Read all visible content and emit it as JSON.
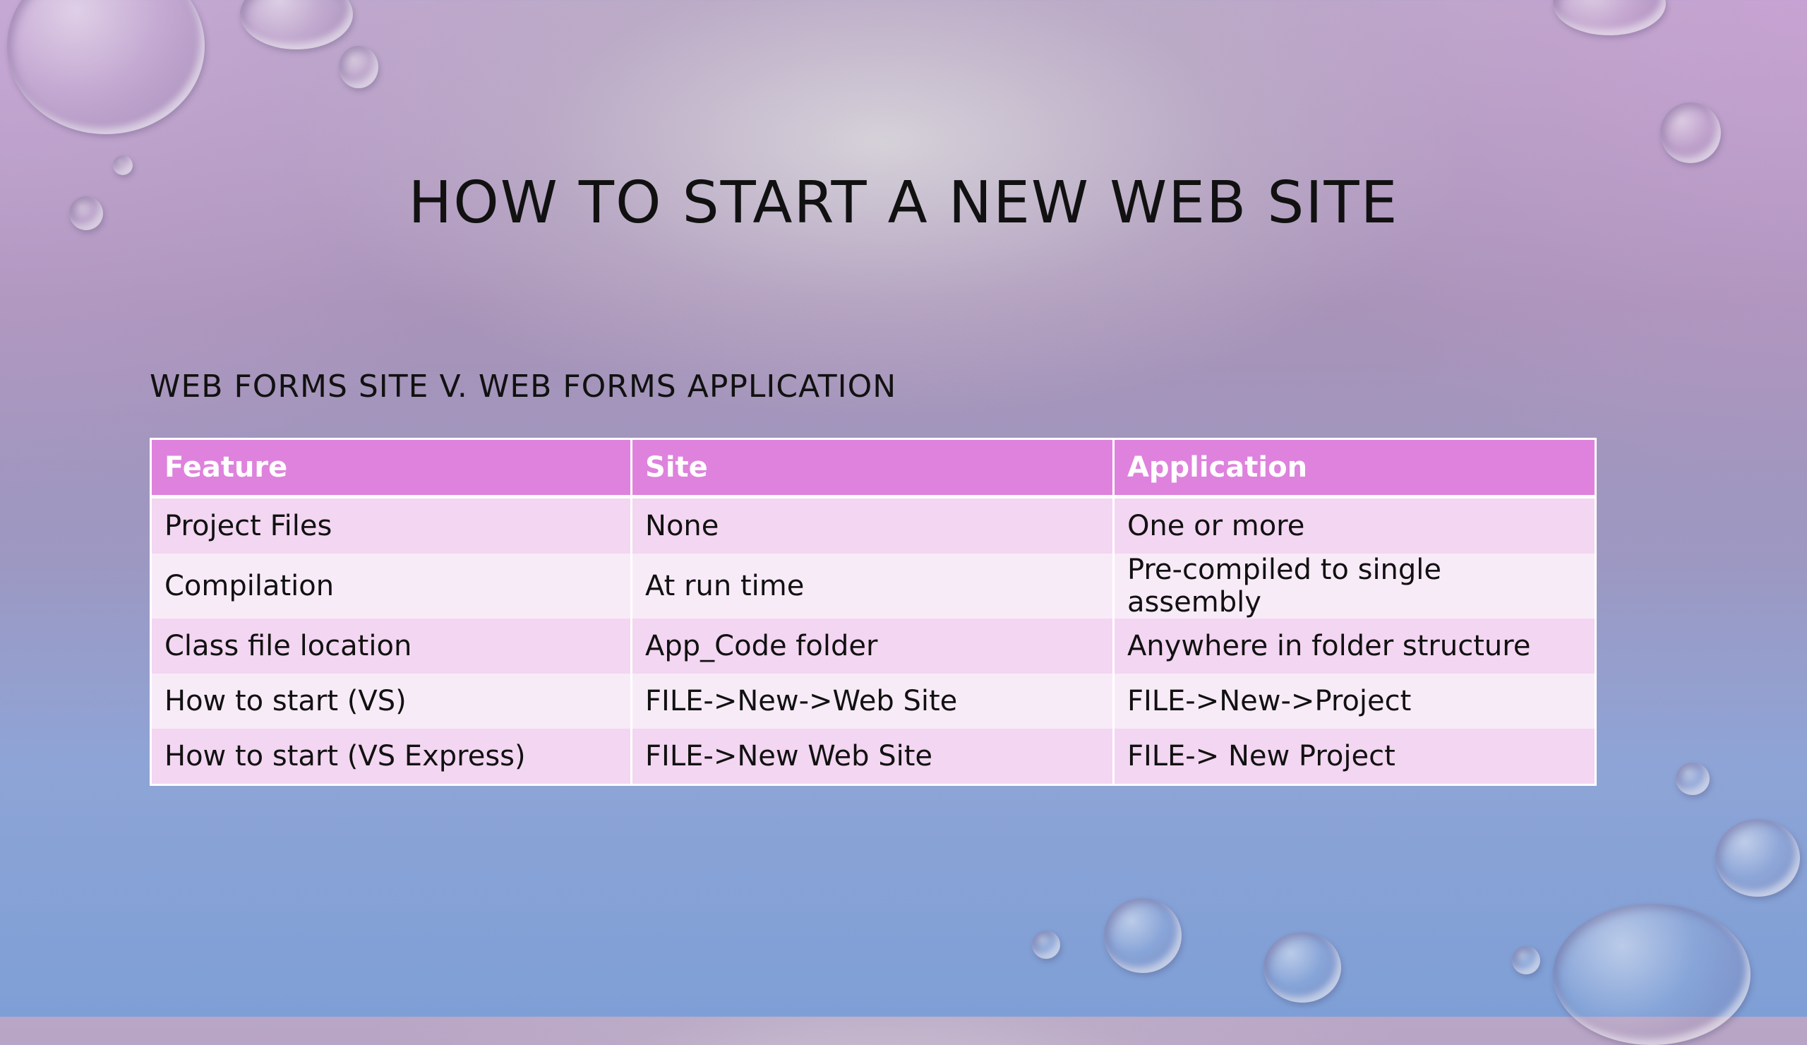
{
  "slide": {
    "title": "HOW TO START A NEW WEB SITE",
    "subtitle": "WEB FORMS SITE V. WEB FORMS APPLICATION"
  },
  "table": {
    "headers": [
      "Feature",
      "Site",
      "Application"
    ],
    "rows": [
      [
        "Project Files",
        "None",
        "One or more"
      ],
      [
        "Compilation",
        "At run time",
        "Pre-compiled to single assembly"
      ],
      [
        "Class file location",
        "App_Code folder",
        "Anywhere in folder structure"
      ],
      [
        "How to start (VS)",
        "FILE->New->Web Site",
        "FILE->New->Project"
      ],
      [
        "How to start (VS Express)",
        "FILE->New Web Site",
        "FILE-> New Project"
      ]
    ]
  },
  "colors": {
    "header_bg": "#de82dd",
    "row_odd": "#f3d6f1",
    "row_even": "#f8ebf8"
  }
}
